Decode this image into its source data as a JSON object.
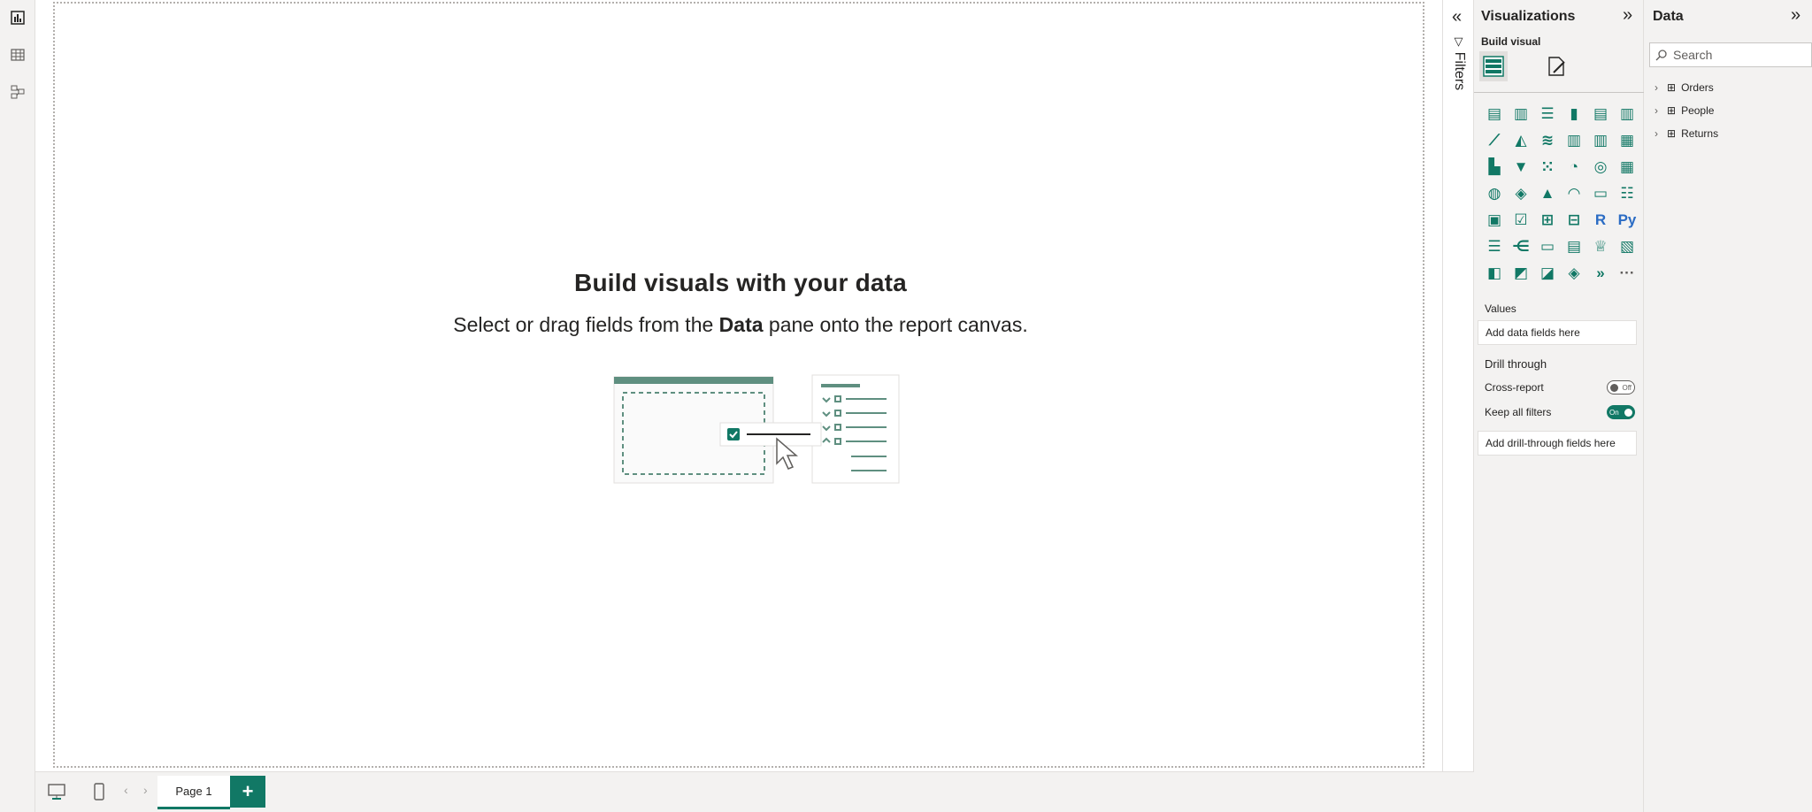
{
  "canvas": {
    "empty_title": "Build visuals with your data",
    "empty_sub_before": "Select or drag fields from the ",
    "empty_sub_bold": "Data",
    "empty_sub_after": " pane onto the report canvas."
  },
  "bottom_bar": {
    "page_tab": "Page 1",
    "add_page": "+"
  },
  "filters": {
    "label": "Filters",
    "collapse_glyph": "«"
  },
  "visualizations": {
    "title": "Visualizations",
    "expand_glyph": "»",
    "build_visual": "Build visual",
    "grid": [
      {
        "name": "stacked-bar-chart-icon",
        "glyph": "▤"
      },
      {
        "name": "stacked-column-chart-icon",
        "glyph": "▥"
      },
      {
        "name": "clustered-bar-chart-icon",
        "glyph": "☰"
      },
      {
        "name": "clustered-column-chart-icon",
        "glyph": "▮"
      },
      {
        "name": "100-stacked-bar-chart-icon",
        "glyph": "▤"
      },
      {
        "name": "100-stacked-column-chart-icon",
        "glyph": "▥"
      },
      {
        "name": "line-chart-icon",
        "glyph": "⟋"
      },
      {
        "name": "area-chart-icon",
        "glyph": "◭"
      },
      {
        "name": "stacked-area-chart-icon",
        "glyph": "≋"
      },
      {
        "name": "line-and-stacked-column-chart-icon",
        "glyph": "▥"
      },
      {
        "name": "line-and-clustered-column-chart-icon",
        "glyph": "▥"
      },
      {
        "name": "ribbon-chart-icon",
        "glyph": "▦"
      },
      {
        "name": "waterfall-chart-icon",
        "glyph": "▙"
      },
      {
        "name": "funnel-icon",
        "glyph": "▼"
      },
      {
        "name": "scatter-chart-icon",
        "glyph": "⁙"
      },
      {
        "name": "pie-chart-icon",
        "glyph": "◔"
      },
      {
        "name": "donut-chart-icon",
        "glyph": "◎"
      },
      {
        "name": "treemap-icon",
        "glyph": "▦"
      },
      {
        "name": "map-icon",
        "glyph": "◍"
      },
      {
        "name": "filled-map-icon",
        "glyph": "◈"
      },
      {
        "name": "azure-map-icon",
        "glyph": "▲"
      },
      {
        "name": "gauge-icon",
        "glyph": "◠"
      },
      {
        "name": "card-icon",
        "glyph": "▭"
      },
      {
        "name": "multi-row-card-icon",
        "glyph": "☷"
      },
      {
        "name": "kpi-icon",
        "glyph": "▣"
      },
      {
        "name": "slicer-icon",
        "glyph": "☑"
      },
      {
        "name": "table-icon",
        "glyph": "⊞"
      },
      {
        "name": "matrix-icon",
        "glyph": "⊟"
      },
      {
        "name": "r-script-visual-icon",
        "glyph": "R",
        "blue": true
      },
      {
        "name": "python-visual-icon",
        "glyph": "Py",
        "blue": true
      },
      {
        "name": "key-influencers-icon",
        "glyph": "☰"
      },
      {
        "name": "decomposition-tree-icon",
        "glyph": "⋲"
      },
      {
        "name": "qa-icon",
        "glyph": "▭"
      },
      {
        "name": "smart-narrative-icon",
        "glyph": "▤"
      },
      {
        "name": "metrics-icon",
        "glyph": "♕"
      },
      {
        "name": "paginated-report-icon",
        "glyph": "▧"
      },
      {
        "name": "power-apps-icon",
        "glyph": "◧"
      },
      {
        "name": "power-automate-icon",
        "glyph": "◩"
      },
      {
        "name": "arcgis-map-icon",
        "glyph": "◪"
      },
      {
        "name": "power-automate-flow-icon",
        "glyph": "◈"
      },
      {
        "name": "copilot-icon",
        "glyph": "»"
      },
      {
        "name": "more-visuals-icon",
        "glyph": "···",
        "gray": true
      }
    ],
    "values_label": "Values",
    "values_well": "Add data fields here",
    "drill_label": "Drill through",
    "cross_report_label": "Cross-report",
    "cross_report_toggle": "Off",
    "keep_filters_label": "Keep all filters",
    "keep_filters_toggle": "On",
    "drill_well": "Add drill-through fields here"
  },
  "data_pane": {
    "title": "Data",
    "expand_glyph": "»",
    "search_placeholder": "Search",
    "tables": [
      "Orders",
      "People",
      "Returns"
    ]
  },
  "colors": {
    "accent": "#117865",
    "pane_bg": "#f3f2f1",
    "canvas_bg": "#ffffff"
  }
}
